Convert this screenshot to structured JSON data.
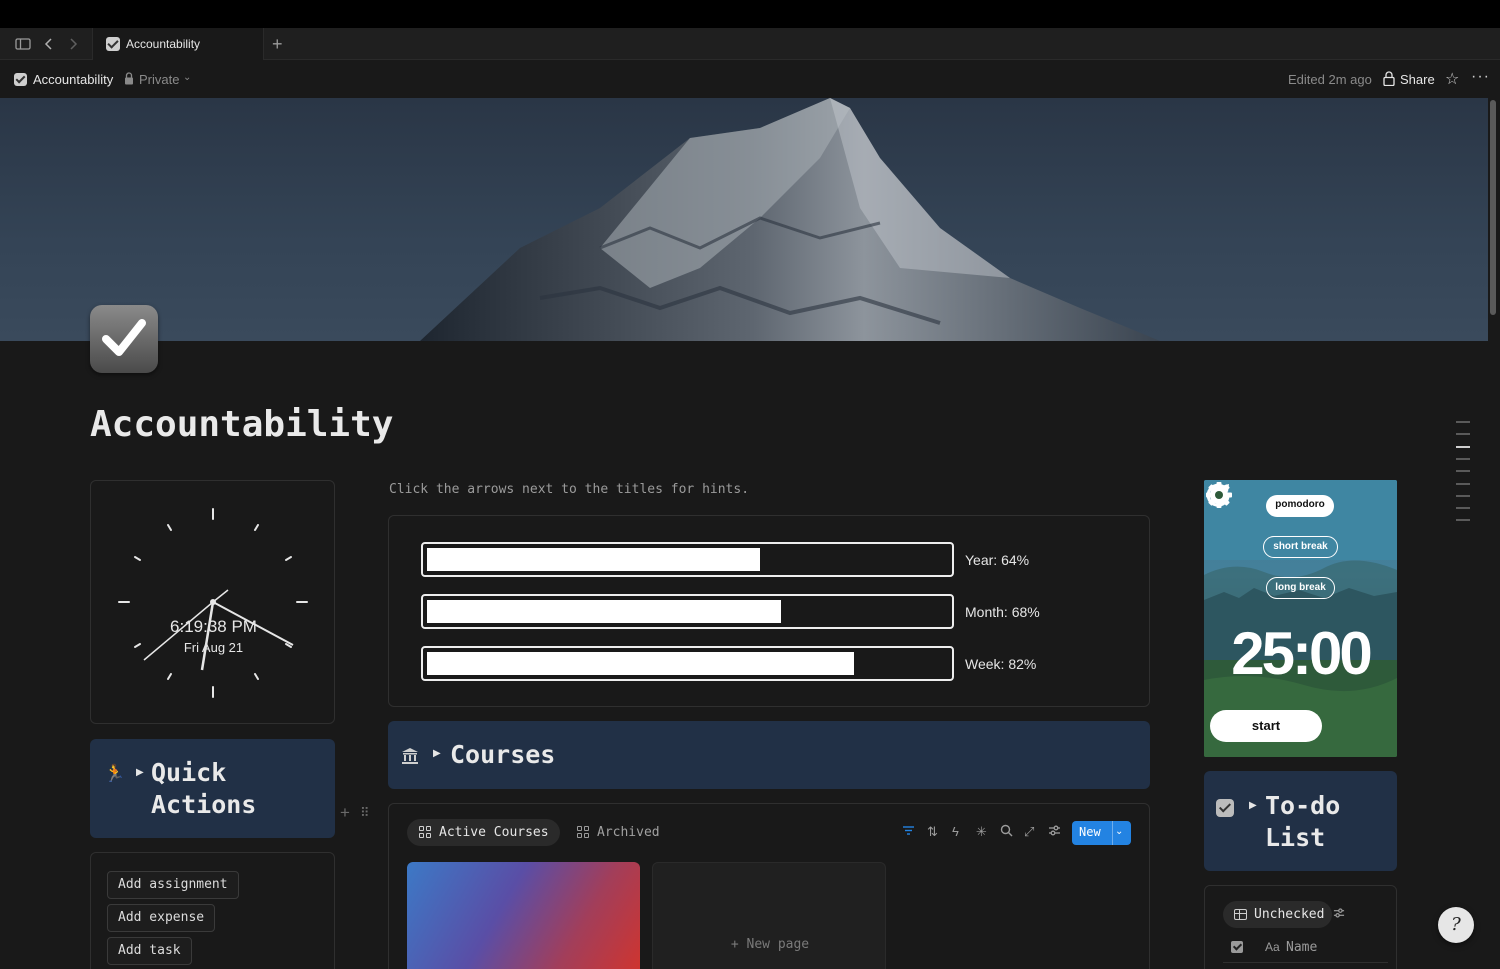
{
  "tabbar": {
    "tab_title": "Accountability",
    "new_tab_symbol": "+",
    "icons": [
      "sidebar-toggle-icon",
      "back-arrow-icon",
      "forward-arrow-icon"
    ]
  },
  "header": {
    "page_title": "Accountability",
    "privacy": "Private",
    "edited": "Edited 2m ago",
    "share_label": "Share",
    "star_symbol": "☆",
    "more_symbol": "···"
  },
  "page": {
    "title": "Accountability",
    "hint": "Click the arrows next to the titles for hints."
  },
  "clock": {
    "time": "6:19:38 PM",
    "date": "Fri Aug 21"
  },
  "quick_actions": {
    "title": "Quick Actions",
    "icon": "runner-icon",
    "buttons": [
      "Add assignment",
      "Add expense",
      "Add task"
    ]
  },
  "progress": [
    {
      "label": "Year: 64%",
      "fraction": 0.64
    },
    {
      "label": "Month: 68%",
      "fraction": 0.68
    },
    {
      "label": "Week: 82%",
      "fraction": 0.82
    }
  ],
  "courses": {
    "title": "Courses",
    "icon": "bank-icon",
    "views": [
      "Active Courses",
      "Archived"
    ],
    "new_label": "New",
    "new_page_label": "+ New page",
    "toolbar_icons": [
      "filter-icon",
      "sort-icon",
      "automation-icon",
      "ai-icon",
      "search-icon",
      "expand-icon",
      "settings-icon"
    ]
  },
  "pomodoro": {
    "modes": [
      "pomodoro",
      "short break",
      "long break"
    ],
    "time": "25:00",
    "start_label": "start"
  },
  "todo": {
    "title": "To-do List",
    "view": "Unchecked",
    "column_icon": "Aa",
    "column_name": "Name"
  },
  "help": {
    "symbol": "?"
  },
  "colors": {
    "accent_blue": "#2383e2",
    "callout_bg": "#213046",
    "page_bg": "#191919"
  }
}
